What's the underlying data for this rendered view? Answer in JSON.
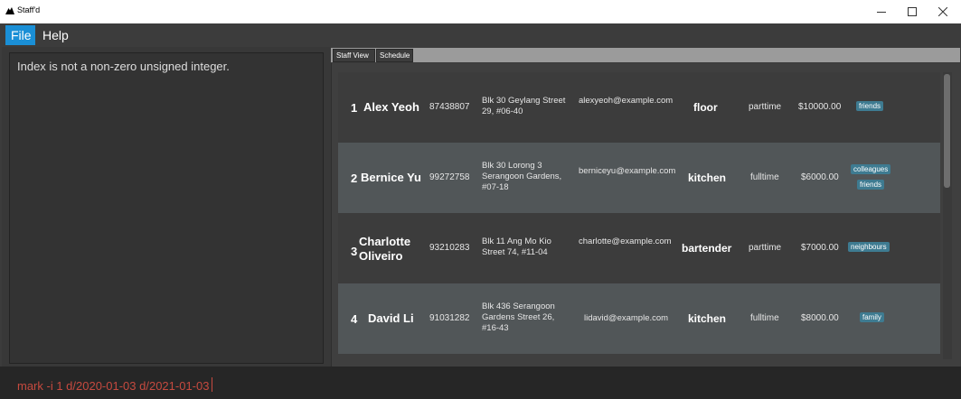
{
  "window": {
    "title": "Staff'd",
    "icons": {
      "app": "mountain-icon",
      "minimize": "minimize-icon",
      "maximize": "maximize-icon",
      "close": "close-icon"
    }
  },
  "menu": {
    "file": "File",
    "help": "Help"
  },
  "result": {
    "text": "Index is not a non-zero unsigned integer."
  },
  "tabs": {
    "staff_view": "Staff View",
    "schedule": "Schedule"
  },
  "staff": [
    {
      "index": "1",
      "name": "Alex Yeoh",
      "phone": "87438807",
      "address": "Blk 30 Geylang Street 29, #06-40",
      "email": "alexyeoh@example.com",
      "role": "floor",
      "type": "parttime",
      "salary": "$10000.00",
      "tags": [
        "friends"
      ]
    },
    {
      "index": "2",
      "name": "Bernice Yu",
      "phone": "99272758",
      "address": "Blk 30 Lorong 3 Serangoon Gardens, #07-18",
      "email": "berniceyu@example.com",
      "role": "kitchen",
      "type": "fulltime",
      "salary": "$6000.00",
      "tags": [
        "colleagues",
        "friends"
      ]
    },
    {
      "index": "3",
      "name": "Charlotte Oliveiro",
      "phone": "93210283",
      "address": "Blk 11 Ang Mo Kio Street 74, #11-04",
      "email": "charlotte@example.com",
      "role": "bartender",
      "type": "parttime",
      "salary": "$7000.00",
      "tags": [
        "neighbours"
      ]
    },
    {
      "index": "4",
      "name": "David Li",
      "phone": "91031282",
      "address": "Blk 436 Serangoon Gardens Street 26, #16-43",
      "email": "lidavid@example.com",
      "role": "kitchen",
      "type": "fulltime",
      "salary": "$8000.00",
      "tags": [
        "family"
      ]
    }
  ],
  "command": {
    "value": "mark -i 1 d/2020-01-03 d/2021-01-03"
  },
  "colors": {
    "accent": "#1a8fd6",
    "tag": "#3e7b91",
    "command_text": "#c64a3f"
  }
}
